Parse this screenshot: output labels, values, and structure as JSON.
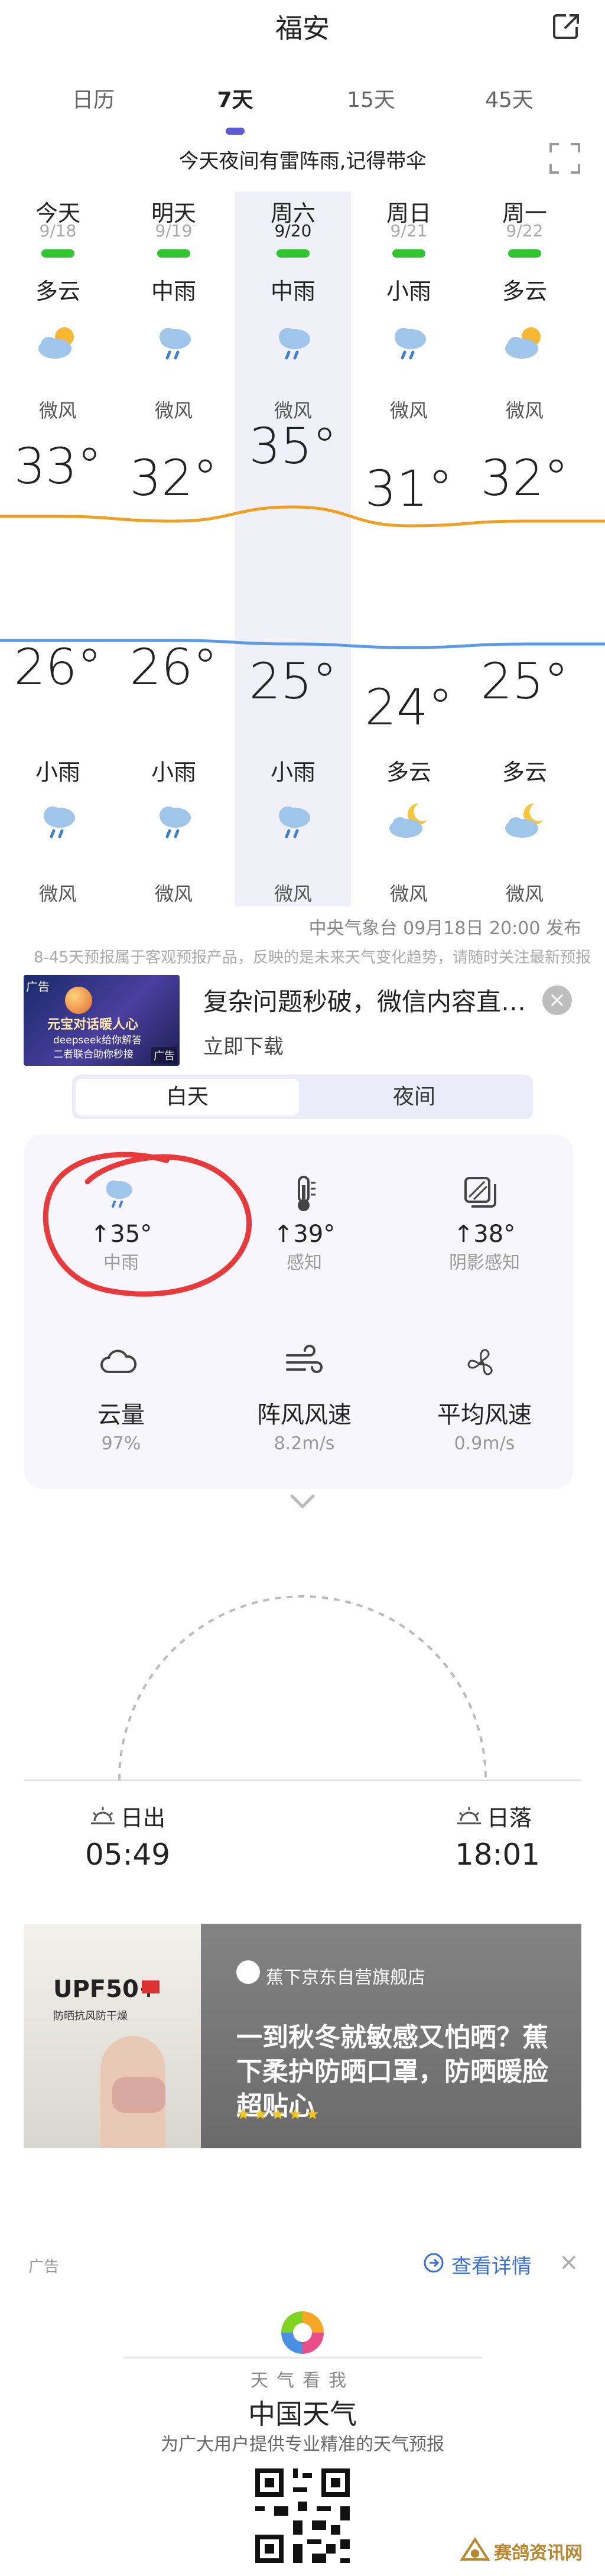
{
  "header": {
    "title": "福安",
    "share_icon": "share-icon"
  },
  "tabs": [
    {
      "label": "日历",
      "active": false
    },
    {
      "label": "7天",
      "active": true
    },
    {
      "label": "15天",
      "active": false
    },
    {
      "label": "45天",
      "active": false
    }
  ],
  "notice": "今天夜间有雷阵雨,记得带伞",
  "forecast": {
    "days": [
      {
        "name": "今天",
        "date": "9/18",
        "day_cond": "多云",
        "day_icon": "partly-cloudy-icon",
        "day_wind": "微风",
        "high": "33°",
        "low": "26°",
        "night_cond": "小雨",
        "night_icon": "rain-icon",
        "night_wind": "微风"
      },
      {
        "name": "明天",
        "date": "9/19",
        "day_cond": "中雨",
        "day_icon": "rain-icon",
        "day_wind": "微风",
        "high": "32°",
        "low": "26°",
        "night_cond": "小雨",
        "night_icon": "rain-icon",
        "night_wind": "微风"
      },
      {
        "name": "周六",
        "date": "9/20",
        "day_cond": "中雨",
        "day_icon": "rain-icon",
        "day_wind": "微风",
        "high": "35°",
        "low": "25°",
        "night_cond": "小雨",
        "night_icon": "rain-icon",
        "night_wind": "微风"
      },
      {
        "name": "周日",
        "date": "9/21",
        "day_cond": "小雨",
        "day_icon": "rain-icon",
        "day_wind": "微风",
        "high": "31°",
        "low": "24°",
        "night_cond": "多云",
        "night_icon": "cloudy-night-icon",
        "night_wind": "微风"
      },
      {
        "name": "周一",
        "date": "9/22",
        "day_cond": "多云",
        "day_icon": "partly-cloudy-icon",
        "day_wind": "微风",
        "high": "32°",
        "low": "25°",
        "night_cond": "多云",
        "night_icon": "cloudy-night-icon",
        "night_wind": "微风"
      }
    ],
    "issued": "中央气象台 09月18日 20:00 发布",
    "disclaimer": "8-45天预报属于客观预报产品，反映的是未来天气变化趋势，请随时关注最新预报"
  },
  "ad1": {
    "tag": "广告",
    "img_text_1": "元宝对话暖人心",
    "img_text_2": "deepseek给你解答",
    "img_text_3": "二者联合助你秒接",
    "title": "复杂问题秒破，微信内容直…",
    "cta": "立即下载"
  },
  "toggle": {
    "day": "白天",
    "night": "夜间"
  },
  "details": [
    {
      "label": "↑35°",
      "value": "中雨",
      "icon": "rain-icon"
    },
    {
      "label": "↑39°",
      "value": "感知",
      "icon": "thermometer-icon"
    },
    {
      "label": "↑38°",
      "value": "阴影感知",
      "icon": "shade-icon"
    },
    {
      "label": "云量",
      "value": "97%",
      "icon": "cloud-icon"
    },
    {
      "label": "阵风风速",
      "value": "8.2m/s",
      "icon": "gust-icon"
    },
    {
      "label": "平均风速",
      "value": "0.9m/s",
      "icon": "fan-icon"
    }
  ],
  "sun": {
    "sunrise_label": "日出",
    "sunrise": "05:49",
    "sunset_label": "日落",
    "sunset": "18:01"
  },
  "ad2": {
    "tag": "广告",
    "badge": "UPF50+",
    "badge_sub": "防晒抗风防干燥",
    "store": "蕉下京东自营旗舰店",
    "text": "一到秋冬就敏感又怕晒？蕉下柔护防晒口罩，防晒暖脸超贴心",
    "detail": "查看详情"
  },
  "footer": {
    "slogan": "天气看我",
    "name": "中国天气",
    "sub": "为广大用户提供专业精准的天气预报"
  },
  "watermark": "赛鸽资讯网",
  "colors": {
    "accent": "#5b5bd6",
    "high_line": "#f0a020",
    "low_line": "#5b9ae8",
    "aqi": "#2fc52f",
    "link": "#3a6fd8"
  }
}
